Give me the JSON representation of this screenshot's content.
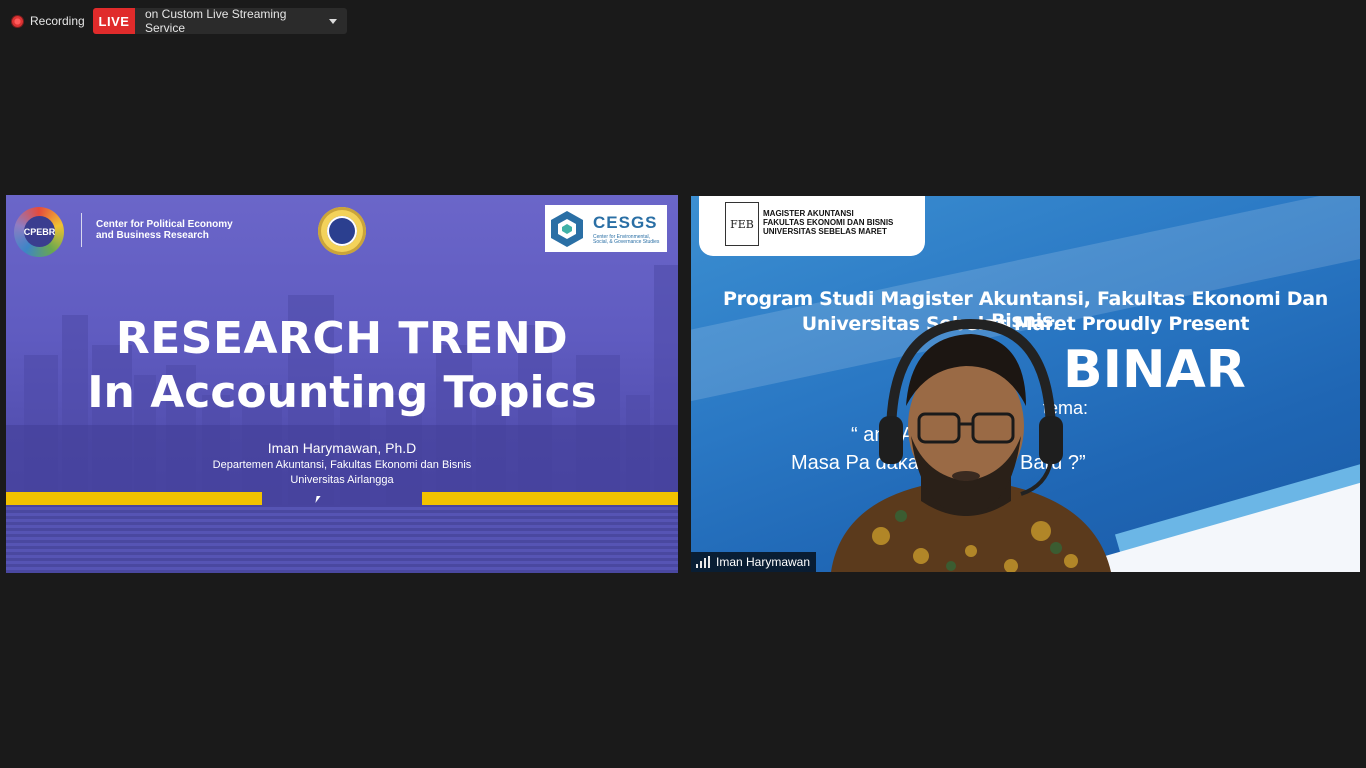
{
  "top_bar": {
    "recording_label": "Recording",
    "live_label": "LIVE",
    "live_target": "on Custom Live Streaming Service",
    "colors": {
      "live_red": "#e02b2b",
      "recording_dot": "#d33333"
    }
  },
  "shared_slide": {
    "cpebr_logo_text": "CPEBR",
    "cpebr_name_line1": "Center for Political Economy",
    "cpebr_name_line2": "and Business Research",
    "cesgs_logo": "CESGS",
    "cesgs_subtitle": "Center for Environmental, Social, & Governance Studies",
    "title_line1": "RESEARCH TREND",
    "title_line2": "In Accounting Topics",
    "author": "Iman Harymawan, Ph.D",
    "department": "Departemen Akuntansi, Fakultas Ekonomi dan Bisnis",
    "university": "Universitas Airlangga",
    "accent_bar_color": "#f2c200",
    "background_color": "#5f5bc0"
  },
  "participant_video": {
    "feb_logo": "FEB",
    "feb_name_line1": "MAGISTER AKUNTANSI",
    "feb_name_line2": "FAKULTAS EKONOMI DAN BISNIS",
    "feb_name_line3": "UNIVERSITAS SEBELAS MARET",
    "banner_line1": "Program Studi Magister Akuntansi, Fakultas Ekonomi Dan Bisnis,",
    "banner_line2": "Universitas Sebelas Maret Proudly Present",
    "banner_word": "BINAR",
    "banner_tema": "tema:",
    "banner_topic1": "“                    ang Akuntansi di",
    "banner_topic2": "Masa Pa                    dakah Hal yang Baru ?”",
    "participant_name": "Iman Harymawan",
    "background_color": "#2a78c4"
  }
}
